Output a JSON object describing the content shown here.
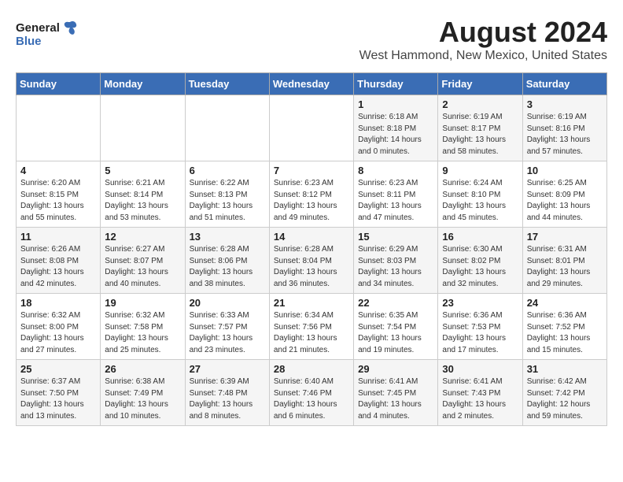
{
  "header": {
    "title": "August 2024",
    "subtitle": "West Hammond, New Mexico, United States"
  },
  "logo": {
    "general": "General",
    "blue": "Blue"
  },
  "columns": [
    "Sunday",
    "Monday",
    "Tuesday",
    "Wednesday",
    "Thursday",
    "Friday",
    "Saturday"
  ],
  "weeks": [
    [
      {
        "day": "",
        "info": ""
      },
      {
        "day": "",
        "info": ""
      },
      {
        "day": "",
        "info": ""
      },
      {
        "day": "",
        "info": ""
      },
      {
        "day": "1",
        "info": "Sunrise: 6:18 AM\nSunset: 8:18 PM\nDaylight: 14 hours\nand 0 minutes."
      },
      {
        "day": "2",
        "info": "Sunrise: 6:19 AM\nSunset: 8:17 PM\nDaylight: 13 hours\nand 58 minutes."
      },
      {
        "day": "3",
        "info": "Sunrise: 6:19 AM\nSunset: 8:16 PM\nDaylight: 13 hours\nand 57 minutes."
      }
    ],
    [
      {
        "day": "4",
        "info": "Sunrise: 6:20 AM\nSunset: 8:15 PM\nDaylight: 13 hours\nand 55 minutes."
      },
      {
        "day": "5",
        "info": "Sunrise: 6:21 AM\nSunset: 8:14 PM\nDaylight: 13 hours\nand 53 minutes."
      },
      {
        "day": "6",
        "info": "Sunrise: 6:22 AM\nSunset: 8:13 PM\nDaylight: 13 hours\nand 51 minutes."
      },
      {
        "day": "7",
        "info": "Sunrise: 6:23 AM\nSunset: 8:12 PM\nDaylight: 13 hours\nand 49 minutes."
      },
      {
        "day": "8",
        "info": "Sunrise: 6:23 AM\nSunset: 8:11 PM\nDaylight: 13 hours\nand 47 minutes."
      },
      {
        "day": "9",
        "info": "Sunrise: 6:24 AM\nSunset: 8:10 PM\nDaylight: 13 hours\nand 45 minutes."
      },
      {
        "day": "10",
        "info": "Sunrise: 6:25 AM\nSunset: 8:09 PM\nDaylight: 13 hours\nand 44 minutes."
      }
    ],
    [
      {
        "day": "11",
        "info": "Sunrise: 6:26 AM\nSunset: 8:08 PM\nDaylight: 13 hours\nand 42 minutes."
      },
      {
        "day": "12",
        "info": "Sunrise: 6:27 AM\nSunset: 8:07 PM\nDaylight: 13 hours\nand 40 minutes."
      },
      {
        "day": "13",
        "info": "Sunrise: 6:28 AM\nSunset: 8:06 PM\nDaylight: 13 hours\nand 38 minutes."
      },
      {
        "day": "14",
        "info": "Sunrise: 6:28 AM\nSunset: 8:04 PM\nDaylight: 13 hours\nand 36 minutes."
      },
      {
        "day": "15",
        "info": "Sunrise: 6:29 AM\nSunset: 8:03 PM\nDaylight: 13 hours\nand 34 minutes."
      },
      {
        "day": "16",
        "info": "Sunrise: 6:30 AM\nSunset: 8:02 PM\nDaylight: 13 hours\nand 32 minutes."
      },
      {
        "day": "17",
        "info": "Sunrise: 6:31 AM\nSunset: 8:01 PM\nDaylight: 13 hours\nand 29 minutes."
      }
    ],
    [
      {
        "day": "18",
        "info": "Sunrise: 6:32 AM\nSunset: 8:00 PM\nDaylight: 13 hours\nand 27 minutes."
      },
      {
        "day": "19",
        "info": "Sunrise: 6:32 AM\nSunset: 7:58 PM\nDaylight: 13 hours\nand 25 minutes."
      },
      {
        "day": "20",
        "info": "Sunrise: 6:33 AM\nSunset: 7:57 PM\nDaylight: 13 hours\nand 23 minutes."
      },
      {
        "day": "21",
        "info": "Sunrise: 6:34 AM\nSunset: 7:56 PM\nDaylight: 13 hours\nand 21 minutes."
      },
      {
        "day": "22",
        "info": "Sunrise: 6:35 AM\nSunset: 7:54 PM\nDaylight: 13 hours\nand 19 minutes."
      },
      {
        "day": "23",
        "info": "Sunrise: 6:36 AM\nSunset: 7:53 PM\nDaylight: 13 hours\nand 17 minutes."
      },
      {
        "day": "24",
        "info": "Sunrise: 6:36 AM\nSunset: 7:52 PM\nDaylight: 13 hours\nand 15 minutes."
      }
    ],
    [
      {
        "day": "25",
        "info": "Sunrise: 6:37 AM\nSunset: 7:50 PM\nDaylight: 13 hours\nand 13 minutes."
      },
      {
        "day": "26",
        "info": "Sunrise: 6:38 AM\nSunset: 7:49 PM\nDaylight: 13 hours\nand 10 minutes."
      },
      {
        "day": "27",
        "info": "Sunrise: 6:39 AM\nSunset: 7:48 PM\nDaylight: 13 hours\nand 8 minutes."
      },
      {
        "day": "28",
        "info": "Sunrise: 6:40 AM\nSunset: 7:46 PM\nDaylight: 13 hours\nand 6 minutes."
      },
      {
        "day": "29",
        "info": "Sunrise: 6:41 AM\nSunset: 7:45 PM\nDaylight: 13 hours\nand 4 minutes."
      },
      {
        "day": "30",
        "info": "Sunrise: 6:41 AM\nSunset: 7:43 PM\nDaylight: 13 hours\nand 2 minutes."
      },
      {
        "day": "31",
        "info": "Sunrise: 6:42 AM\nSunset: 7:42 PM\nDaylight: 12 hours\nand 59 minutes."
      }
    ]
  ]
}
